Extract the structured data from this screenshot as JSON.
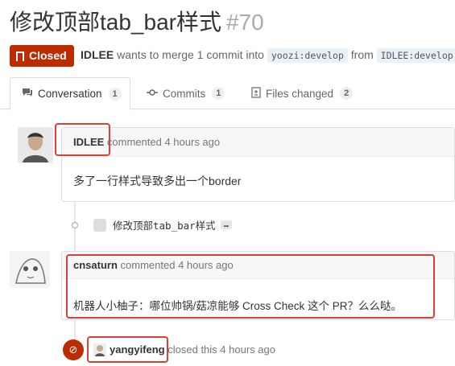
{
  "title": "修改顶部tab_bar样式",
  "number": "#70",
  "state": "Closed",
  "meta": {
    "author": "IDLEE",
    "text1": "wants to merge 1 commit into",
    "base_branch": "yoozi:develop",
    "text2": "from",
    "head_branch": "IDLEE:develop"
  },
  "tabs": [
    {
      "label": "Conversation",
      "count": "1"
    },
    {
      "label": "Commits",
      "count": "1"
    },
    {
      "label": "Files changed",
      "count": "2"
    }
  ],
  "comments": [
    {
      "author": "IDLEE",
      "time": "commented 4 hours ago",
      "body": "多了一行样式导致多出一个border"
    },
    {
      "author": "cnsaturn",
      "time": "commented 4 hours ago",
      "body": "机器人小柚子：哪位帅锅/菇凉能够 Cross Check 这个 PR？么么哒。"
    }
  ],
  "commit": {
    "message": "修改顶部tab_bar样式",
    "ellipsis": "…"
  },
  "closed_event": {
    "author": "yangyifeng",
    "text": "closed this 4 hours ago"
  },
  "colors": {
    "closed": "#bd2c00",
    "highlight": "#d9403a"
  }
}
